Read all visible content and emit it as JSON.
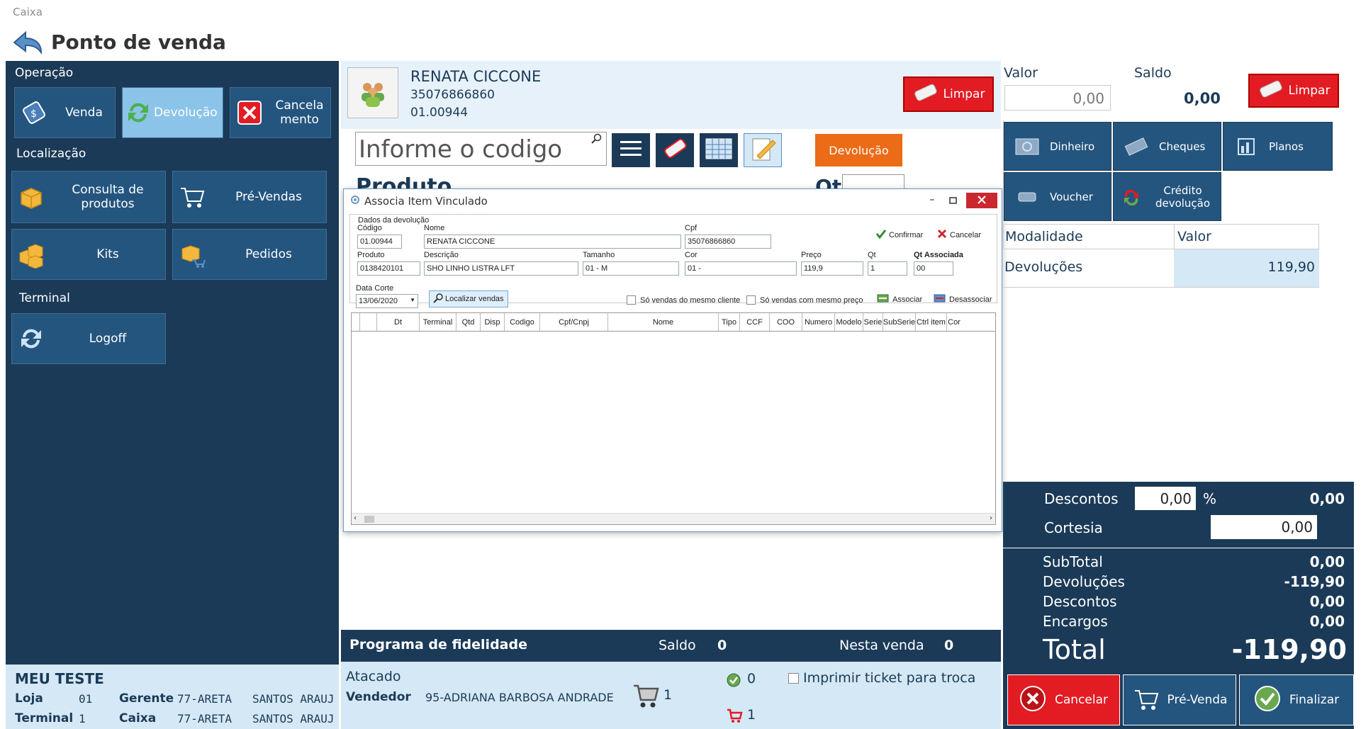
{
  "app": {
    "window_label": "Caixa",
    "title": "Ponto de venda"
  },
  "left": {
    "operacao_label": "Operação",
    "venda": "Venda",
    "devolucao": "Devolução",
    "cancelamento": "Cancela\nmento",
    "localizacao_label": "Localização",
    "consulta": "Consulta de produtos",
    "prevendas": "Pré-Vendas",
    "kits": "Kits",
    "pedidos": "Pedidos",
    "terminal_label": "Terminal",
    "logoff": "Logoff",
    "user_name": "MEU TESTE",
    "loja_label": "Loja",
    "loja_value": "01",
    "gerente_label": "Gerente",
    "gerente_value": "77-ARETA   SANTOS ARAUJ",
    "terminal_row_label": "Terminal",
    "terminal_value": "1",
    "caixa_label": "Caixa",
    "caixa_value": "77-ARETA   SANTOS ARAUJ"
  },
  "customer": {
    "name": "RENATA CICCONE",
    "cpf": "35076866860",
    "code": "01.00944"
  },
  "center": {
    "limpar": "Limpar",
    "search_placeholder": "Informe o codigo",
    "devolucao_btn": "Devolução",
    "produto_label": "Produto",
    "qt_label": "Qt"
  },
  "dialog": {
    "title": "Associa Item Vinculado",
    "group": "Dados da devolução",
    "codigo_label": "Código",
    "codigo": "01.00944",
    "nome_label": "Nome",
    "nome": "RENATA CICCONE",
    "cpf_label": "Cpf",
    "cpf": "35076866860",
    "confirmar": "Confirmar",
    "cancelar": "Cancelar",
    "produto_label": "Produto",
    "produto": "0138420101",
    "descricao_label": "Descrição",
    "descricao": "SHO LINHO LISTRA LFT",
    "tamanho_label": "Tamanho",
    "tamanho": "01 - M",
    "cor_label": "Cor",
    "cor": "01 -",
    "preco_label": "Preço",
    "preco": "119,9",
    "qt_label": "Qt",
    "qt": "1",
    "qt_assoc_label": "Qt Associada",
    "qt_assoc": "00",
    "data_corte_label": "Data Corte",
    "data_corte": "13/06/2020",
    "localizar": "Localizar vendas",
    "so_cliente": "Só vendas do mesmo cliente",
    "so_preco": "Só vendas com mesmo preço",
    "associar": "Associar",
    "desassociar": "Desassociar",
    "columns": [
      "",
      "Dt",
      "Terminal",
      "Qtd",
      "Disp",
      "Codigo",
      "Cpf/Cnpj",
      "Nome",
      "Tipo",
      "CCF",
      "COO",
      "Numero",
      "Modelo",
      "Serie",
      "SubSerie",
      "Ctrl item",
      "Cor"
    ]
  },
  "fidelidade": {
    "title": "Programa de fidelidade",
    "saldo_label": "Saldo",
    "saldo": "0",
    "nesta_label": "Nesta venda",
    "nesta": "0"
  },
  "bottom_center": {
    "atacado": "Atacado",
    "vendedor_label": "Vendedor",
    "vendedor": "95-ADRIANA BARBOSA ANDRADE",
    "cart_count": "1",
    "ok_count": "0",
    "cart2_count": "1",
    "imprimir": "Imprimir ticket para troca"
  },
  "right": {
    "valor_label": "Valor",
    "valor": "0,00",
    "saldo_label": "Saldo",
    "saldo": "0,00",
    "limpar": "Limpar",
    "dinheiro": "Dinheiro",
    "cheques": "Cheques",
    "planos": "Planos",
    "voucher": "Voucher",
    "credito": "Crédito devolução",
    "mod_header": "Modalidade",
    "valor_header": "Valor",
    "mod_row": "Devoluções",
    "mod_row_value": "119,90",
    "descontos_label": "Descontos",
    "descontos_input": "0,00",
    "pct": "%",
    "descontos_value": "0,00",
    "cortesia_label": "Cortesia",
    "cortesia": "0,00",
    "subtotal_label": "SubTotal",
    "subtotal": "0,00",
    "devolucoes_label": "Devoluções",
    "devolucoes": "-119,90",
    "descontos2_label": "Descontos",
    "descontos2": "0,00",
    "encargos_label": "Encargos",
    "encargos": "0,00",
    "total_label": "Total",
    "total": "-119,90",
    "cancelar": "Cancelar",
    "prevenda": "Pré-Venda",
    "finalizar": "Finalizar"
  }
}
